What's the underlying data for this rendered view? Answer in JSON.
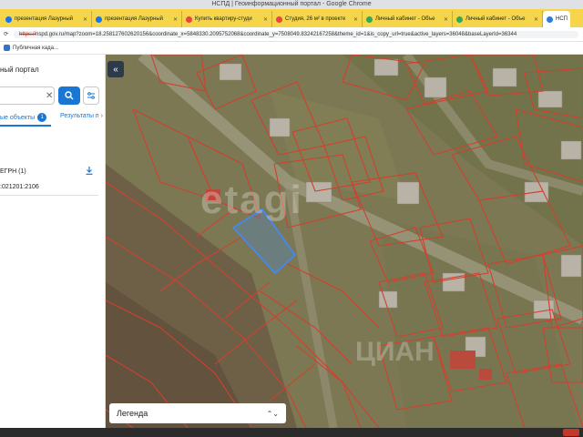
{
  "window": {
    "title": "НСПД | Геоинформационный портал - Google Chrome"
  },
  "tabs": [
    {
      "label": "презентация Лазурный",
      "color": "#1a73e8"
    },
    {
      "label": "презентация Лазурный",
      "color": "#1a73e8"
    },
    {
      "label": "Купить квартиру-студи",
      "color": "#e8453c"
    },
    {
      "label": "Студия, 26 м² в проекте",
      "color": "#e8453c"
    },
    {
      "label": "Личный кабинет - Объе",
      "color": "#34a853"
    },
    {
      "label": "Личный кабинет - Объе",
      "color": "#34a853"
    },
    {
      "label": "НСП",
      "color": "#2d7dd2"
    }
  ],
  "address": {
    "scheme": "https://",
    "rest": "nspd.gov.ru/map?zoom=18.258127602620156&coordinate_x=5848330.2095752068&coordinate_y=7508049.83242167258&theme_id=1&is_copy_url=true&active_layers=36048&baseLayerId=36344"
  },
  "bookmarks": {
    "item": "Публичная када..."
  },
  "panel": {
    "portal": "ный портал",
    "tab_objects": "ые объекты",
    "badge": "1",
    "tab_results": "Результаты п",
    "egrn": "ЕГРН (1)",
    "cadastral": ":021201:2106"
  },
  "map": {
    "watermark": "etagi",
    "watermark2": "ЦИАН",
    "legend": "Легенда"
  }
}
